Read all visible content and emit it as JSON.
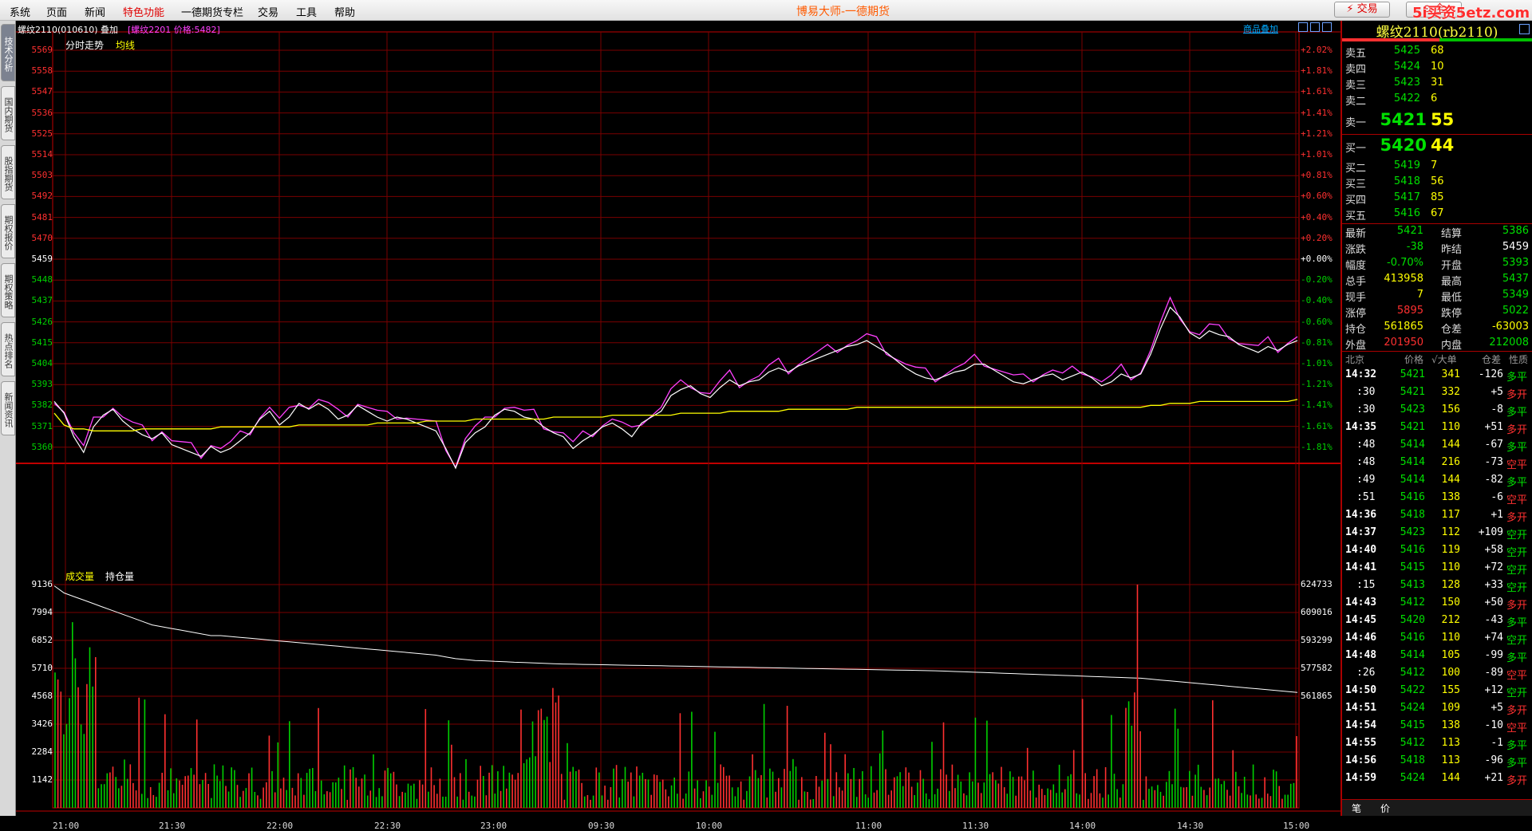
{
  "menubar": {
    "items": [
      "系统",
      "页面",
      "新闻",
      "特色功能",
      "一德期货专栏",
      "交易",
      "工具",
      "帮助"
    ],
    "title": "博易大师-一德期货",
    "trade_btn": "⚡ 交易",
    "btn2": "⊙ 全",
    "watermark": "5i买资5etz.com"
  },
  "sidetabs": [
    "技术分析",
    "国内期货",
    "股指期货",
    "期权报价",
    "期权策略",
    "热点排名",
    "新闻资讯"
  ],
  "chart": {
    "instrument": "螺纹2110(010610)",
    "overlay_label": "叠加",
    "overlay_info": "[螺纹2201 价格:5482]",
    "overlay_btn": "商品叠加",
    "price_label": "分时走势",
    "avg_label": "均线",
    "volume_label": "成交量",
    "oi_label": "持仓量",
    "left_price_axis": [
      "5569",
      "5558",
      "5547",
      "5536",
      "5525",
      "5514",
      "5503",
      "5492",
      "5481",
      "5470",
      "5459",
      "5448",
      "5437",
      "5426",
      "5415",
      "5404",
      "5393",
      "5382",
      "5371",
      "5360"
    ],
    "right_pct_axis": [
      "+2.02%",
      "+1.81%",
      "+1.61%",
      "+1.41%",
      "+1.21%",
      "+1.01%",
      "+0.81%",
      "+0.60%",
      "+0.40%",
      "+0.20%",
      "+0.00%",
      "-0.20%",
      "-0.40%",
      "-0.60%",
      "-0.81%",
      "-1.01%",
      "-1.21%",
      "-1.41%",
      "-1.61%",
      "-1.81%"
    ],
    "vol_axis": [
      "9136",
      "7994",
      "6852",
      "5710",
      "4568",
      "3426",
      "2284",
      "1142"
    ],
    "oi_axis": [
      "624733",
      "609016",
      "593299",
      "577582",
      "561865"
    ],
    "time_axis": [
      "21:00",
      "21:30",
      "22:00",
      "22:30",
      "23:00",
      "09:30",
      "10:00",
      "11:00",
      "11:30",
      "14:00",
      "14:30",
      "15:00"
    ],
    "colors": {
      "price": "#ffffff",
      "overlay": "#ff40ff",
      "avg": "#ffff00",
      "oi": "#ffffff",
      "up": "#ff3030",
      "down": "#00d000",
      "grid": "#7a0000"
    }
  },
  "chart_data": {
    "type": "line",
    "title": "",
    "series": [
      {
        "name": "分时走势",
        "values": [
          5390,
          5384,
          5372,
          5364,
          5377,
          5383,
          5386,
          5380,
          5376,
          5373,
          5371,
          5374,
          5368,
          5366,
          5364,
          5362,
          5367,
          5364,
          5366,
          5370,
          5374,
          5381,
          5385,
          5378,
          5382,
          5389,
          5386,
          5389,
          5386,
          5381,
          5383,
          5388,
          5385,
          5382,
          5380,
          5382,
          5381,
          5379,
          5377,
          5375,
          5366,
          5356,
          5369,
          5374,
          5377,
          5383,
          5386,
          5385,
          5382,
          5381,
          5377,
          5374,
          5372,
          5366,
          5370,
          5373,
          5377,
          5379,
          5376,
          5372,
          5379,
          5382,
          5385,
          5393,
          5396,
          5398,
          5394,
          5392,
          5397,
          5401,
          5398,
          5400,
          5401,
          5405,
          5407,
          5405,
          5408,
          5410,
          5412,
          5414,
          5416,
          5418,
          5419,
          5421,
          5418,
          5415,
          5411,
          5407,
          5404,
          5402,
          5401,
          5403,
          5405,
          5406,
          5409,
          5409,
          5406,
          5403,
          5400,
          5399,
          5401,
          5403,
          5404,
          5401,
          5403,
          5405,
          5402,
          5398,
          5400,
          5404,
          5402,
          5404,
          5414,
          5427,
          5438,
          5433,
          5425,
          5422,
          5426,
          5424,
          5423,
          5419,
          5417,
          5415,
          5418,
          5416,
          5419,
          5421
        ]
      },
      {
        "name": "均线",
        "values": [
          5384,
          5378,
          5376,
          5376,
          5375,
          5375,
          5375,
          5375,
          5375,
          5376,
          5376,
          5376,
          5376,
          5376,
          5376,
          5376,
          5376,
          5377,
          5377,
          5377,
          5377,
          5377,
          5377,
          5377,
          5377,
          5378,
          5378,
          5378,
          5378,
          5378,
          5378,
          5378,
          5378,
          5379,
          5379,
          5379,
          5379,
          5379,
          5380,
          5380,
          5380,
          5380,
          5380,
          5381,
          5381,
          5381,
          5381,
          5381,
          5381,
          5381,
          5381,
          5382,
          5382,
          5382,
          5382,
          5382,
          5382,
          5383,
          5383,
          5383,
          5383,
          5383,
          5383,
          5383,
          5384,
          5384,
          5384,
          5384,
          5384,
          5385,
          5385,
          5385,
          5385,
          5385,
          5385,
          5386,
          5386,
          5386,
          5386,
          5386,
          5386,
          5386,
          5387,
          5387,
          5387,
          5387,
          5387,
          5387,
          5387,
          5387,
          5387,
          5387,
          5387,
          5387,
          5387,
          5387,
          5387,
          5387,
          5387,
          5387,
          5387,
          5387,
          5387,
          5387,
          5387,
          5387,
          5387,
          5387,
          5387,
          5387,
          5387,
          5387,
          5388,
          5388,
          5389,
          5389,
          5389,
          5390,
          5390,
          5390,
          5390,
          5390,
          5390,
          5390,
          5390,
          5390,
          5390,
          5391
        ]
      },
      {
        "name": "持仓量",
        "values": [
          624000,
          620000,
          618000,
          616000,
          614000,
          612000,
          610000,
          608000,
          606000,
          604000,
          602000,
          601000,
          600000,
          599000,
          598000,
          597000,
          596000,
          596000,
          595500,
          595000,
          594500,
          594000,
          593500,
          593000,
          592500,
          592000,
          591500,
          591000,
          590500,
          590000,
          589500,
          589000,
          588500,
          588000,
          587500,
          587000,
          586500,
          586000,
          585500,
          585000,
          584000,
          583000,
          582500,
          582000,
          581800,
          581500,
          581300,
          581000,
          580800,
          580600,
          580400,
          580200,
          580000,
          579900,
          579800,
          579700,
          579600,
          579500,
          579400,
          579300,
          579200,
          579100,
          579000,
          578900,
          578800,
          578700,
          578600,
          578500,
          578400,
          578300,
          578200,
          578100,
          578000,
          577900,
          577800,
          577700,
          577600,
          577500,
          577400,
          577300,
          577200,
          577100,
          577000,
          576900,
          576800,
          576700,
          576600,
          576500,
          576400,
          576300,
          576200,
          576000,
          575800,
          575600,
          575400,
          575200,
          575000,
          574800,
          574600,
          574400,
          574200,
          574000,
          573800,
          573600,
          573400,
          573200,
          573000,
          572800,
          572600,
          572400,
          572200,
          572000,
          571500,
          571000,
          570500,
          570000,
          569500,
          569000,
          568500,
          568000,
          567500,
          567000,
          566500,
          566000,
          565500,
          565000,
          564500,
          564000
        ]
      }
    ],
    "xlabel": "",
    "ylabel": "",
    "ylim": [
      5360,
      5569
    ]
  },
  "quote": {
    "title": "螺纹2110(rb2110)",
    "asks": [
      {
        "name": "卖五",
        "price": "5425",
        "vol": "68"
      },
      {
        "name": "卖四",
        "price": "5424",
        "vol": "10"
      },
      {
        "name": "卖三",
        "price": "5423",
        "vol": "31"
      },
      {
        "name": "卖二",
        "price": "5422",
        "vol": "6"
      }
    ],
    "ask1": {
      "name": "卖一",
      "price": "5421",
      "vol": "55"
    },
    "bid1": {
      "name": "买一",
      "price": "5420",
      "vol": "44"
    },
    "bids": [
      {
        "name": "买二",
        "price": "5419",
        "vol": "7"
      },
      {
        "name": "买三",
        "price": "5418",
        "vol": "56"
      },
      {
        "name": "买四",
        "price": "5417",
        "vol": "85"
      },
      {
        "name": "买五",
        "price": "5416",
        "vol": "67"
      }
    ],
    "stats": [
      {
        "l1": "最新",
        "v1": "5421",
        "c1": "#00e000",
        "l2": "结算",
        "v2": "5386",
        "c2": "#00e000"
      },
      {
        "l1": "涨跌",
        "v1": "-38",
        "c1": "#00e000",
        "l2": "昨结",
        "v2": "5459",
        "c2": "#ffffff"
      },
      {
        "l1": "幅度",
        "v1": "-0.70%",
        "c1": "#00e000",
        "l2": "开盘",
        "v2": "5393",
        "c2": "#00e000"
      },
      {
        "l1": "总手",
        "v1": "413958",
        "c1": "#ffff00",
        "l2": "最高",
        "v2": "5437",
        "c2": "#00e000"
      },
      {
        "l1": "现手",
        "v1": "7",
        "c1": "#ffff00",
        "l2": "最低",
        "v2": "5349",
        "c2": "#00e000"
      },
      {
        "l1": "涨停",
        "v1": "5895",
        "c1": "#ff3030",
        "l2": "跌停",
        "v2": "5022",
        "c2": "#00e000"
      },
      {
        "l1": "持仓",
        "v1": "561865",
        "c1": "#ffff00",
        "l2": "仓差",
        "v2": "-63003",
        "c2": "#ffff00"
      },
      {
        "l1": "外盘",
        "v1": "201950",
        "c1": "#ff3030",
        "l2": "内盘",
        "v2": "212008",
        "c2": "#00e000"
      }
    ],
    "tick_header": {
      "time": "北京",
      "price": "价格",
      "big": "√大单",
      "oi": "仓差",
      "nature": "性质"
    },
    "ticks": [
      {
        "time": "14:32",
        "price": "5421",
        "vol": "341",
        "oi": "-126",
        "nature": "多平",
        "pc": "#00e000",
        "nc": "#00e000"
      },
      {
        "time": ":30",
        "price": "5421",
        "vol": "332",
        "oi": "+5",
        "nature": "多开",
        "pc": "#00e000",
        "nc": "#ff3030"
      },
      {
        "time": ":30",
        "price": "5423",
        "vol": "156",
        "oi": "-8",
        "nature": "多平",
        "pc": "#00e000",
        "nc": "#00e000"
      },
      {
        "time": "14:35",
        "price": "5421",
        "vol": "110",
        "oi": "+51",
        "nature": "多开",
        "pc": "#00e000",
        "nc": "#ff3030"
      },
      {
        "time": ":48",
        "price": "5414",
        "vol": "144",
        "oi": "-67",
        "nature": "多平",
        "pc": "#00e000",
        "nc": "#00e000"
      },
      {
        "time": ":48",
        "price": "5414",
        "vol": "216",
        "oi": "-73",
        "nature": "空平",
        "pc": "#00e000",
        "nc": "#ff3030"
      },
      {
        "time": ":49",
        "price": "5414",
        "vol": "144",
        "oi": "-82",
        "nature": "多平",
        "pc": "#00e000",
        "nc": "#00e000"
      },
      {
        "time": ":51",
        "price": "5416",
        "vol": "138",
        "oi": "-6",
        "nature": "空平",
        "pc": "#00e000",
        "nc": "#ff3030"
      },
      {
        "time": "14:36",
        "price": "5418",
        "vol": "117",
        "oi": "+1",
        "nature": "多开",
        "pc": "#00e000",
        "nc": "#ff3030"
      },
      {
        "time": "14:37",
        "price": "5423",
        "vol": "112",
        "oi": "+109",
        "nature": "空开",
        "pc": "#00e000",
        "nc": "#00e000"
      },
      {
        "time": "14:40",
        "price": "5416",
        "vol": "119",
        "oi": "+58",
        "nature": "空开",
        "pc": "#00e000",
        "nc": "#00e000"
      },
      {
        "time": "14:41",
        "price": "5415",
        "vol": "110",
        "oi": "+72",
        "nature": "空开",
        "pc": "#00e000",
        "nc": "#00e000"
      },
      {
        "time": ":15",
        "price": "5413",
        "vol": "128",
        "oi": "+33",
        "nature": "空开",
        "pc": "#00e000",
        "nc": "#00e000"
      },
      {
        "time": "14:43",
        "price": "5412",
        "vol": "150",
        "oi": "+50",
        "nature": "多开",
        "pc": "#00e000",
        "nc": "#ff3030"
      },
      {
        "time": "14:45",
        "price": "5420",
        "vol": "212",
        "oi": "-43",
        "nature": "多平",
        "pc": "#00e000",
        "nc": "#00e000"
      },
      {
        "time": "14:46",
        "price": "5416",
        "vol": "110",
        "oi": "+74",
        "nature": "空开",
        "pc": "#00e000",
        "nc": "#00e000"
      },
      {
        "time": "14:48",
        "price": "5414",
        "vol": "105",
        "oi": "-99",
        "nature": "多平",
        "pc": "#00e000",
        "nc": "#00e000"
      },
      {
        "time": ":26",
        "price": "5412",
        "vol": "100",
        "oi": "-89",
        "nature": "空平",
        "pc": "#00e000",
        "nc": "#ff3030"
      },
      {
        "time": "14:50",
        "price": "5422",
        "vol": "155",
        "oi": "+12",
        "nature": "空开",
        "pc": "#00e000",
        "nc": "#00e000"
      },
      {
        "time": "14:51",
        "price": "5424",
        "vol": "109",
        "oi": "+5",
        "nature": "多开",
        "pc": "#00e000",
        "nc": "#ff3030"
      },
      {
        "time": "14:54",
        "price": "5415",
        "vol": "138",
        "oi": "-10",
        "nature": "空平",
        "pc": "#00e000",
        "nc": "#ff3030"
      },
      {
        "time": "14:55",
        "price": "5412",
        "vol": "113",
        "oi": "-1",
        "nature": "多平",
        "pc": "#00e000",
        "nc": "#00e000"
      },
      {
        "time": "14:56",
        "price": "5418",
        "vol": "113",
        "oi": "-96",
        "nature": "多平",
        "pc": "#00e000",
        "nc": "#00e000"
      },
      {
        "time": "14:59",
        "price": "5424",
        "vol": "144",
        "oi": "+21",
        "nature": "多开",
        "pc": "#00e000",
        "nc": "#ff3030"
      }
    ],
    "bottom_tabs": [
      "笔",
      "价"
    ]
  }
}
